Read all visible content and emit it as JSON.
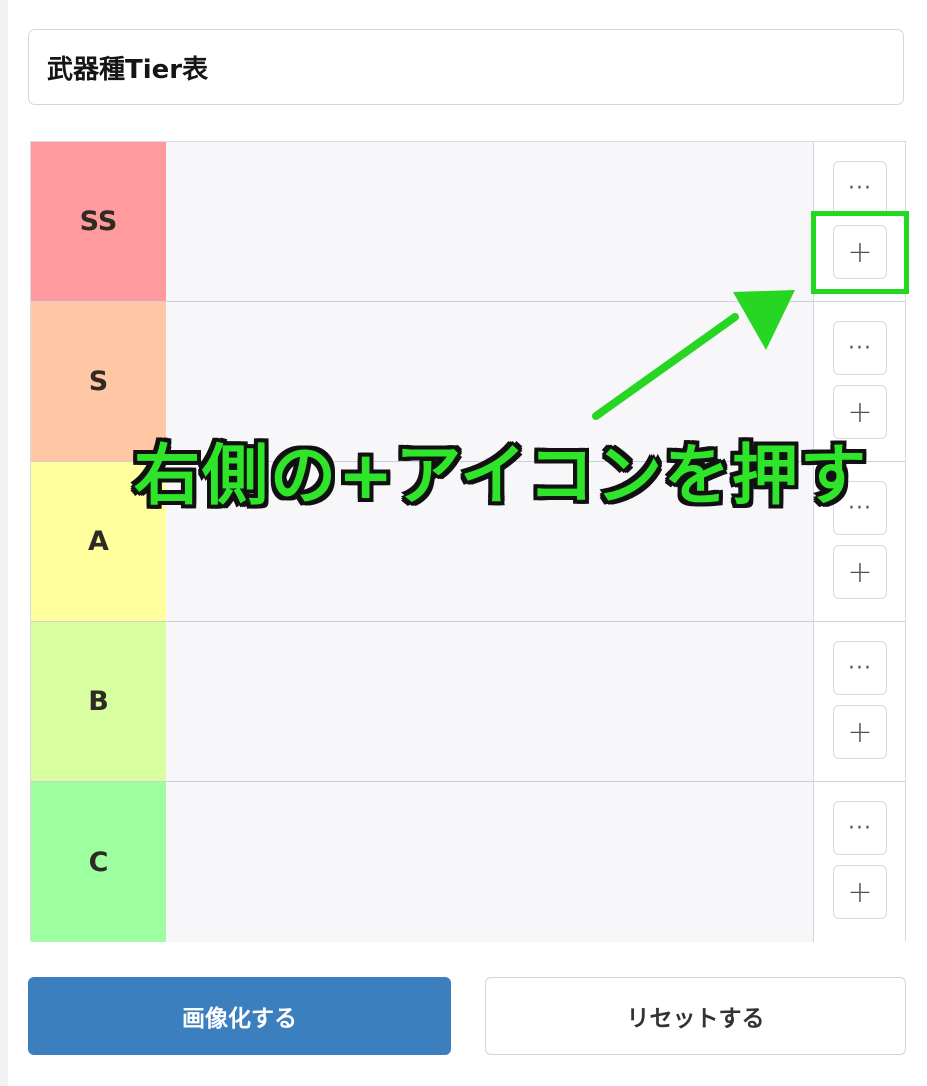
{
  "title": "武器種Tier表",
  "tiers": [
    {
      "label": "SS",
      "color": "#ff9a9e",
      "more_icon": "ellipsis-icon",
      "add_icon": "plus-icon",
      "more_symbol": "···",
      "add_symbol": "+"
    },
    {
      "label": "S",
      "color": "#ffc7a3",
      "more_icon": "ellipsis-icon",
      "add_icon": "plus-icon",
      "more_symbol": "···",
      "add_symbol": "+"
    },
    {
      "label": "A",
      "color": "#ffff9e",
      "more_icon": "ellipsis-icon",
      "add_icon": "plus-icon",
      "more_symbol": "···",
      "add_symbol": "+"
    },
    {
      "label": "B",
      "color": "#d7ffa0",
      "more_icon": "ellipsis-icon",
      "add_icon": "plus-icon",
      "more_symbol": "···",
      "add_symbol": "+"
    },
    {
      "label": "C",
      "color": "#9effa0",
      "more_icon": "ellipsis-icon",
      "add_icon": "plus-icon",
      "more_symbol": "···",
      "add_symbol": "+"
    }
  ],
  "annotation": {
    "text": "右側の+アイコンを押す",
    "color": "#2ee52a"
  },
  "actions": {
    "export_label": "画像化する",
    "reset_label": "リセットする",
    "export_color": "#3b7fbe"
  }
}
